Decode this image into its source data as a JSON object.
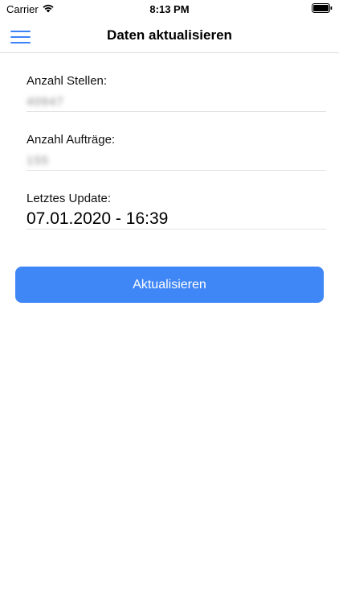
{
  "status_bar": {
    "carrier": "Carrier",
    "time": "8:13 PM",
    "wifi_icon": "wifi-icon",
    "battery_icon": "battery-icon"
  },
  "nav": {
    "title": "Daten aktualisieren",
    "menu_icon": "menu-icon",
    "accent_color": "#3d82f5"
  },
  "info": {
    "stellen_label": "Anzahl Stellen:",
    "stellen_value": "40947",
    "auftraege_label": "Anzahl Aufträge:",
    "auftraege_value": "155",
    "update_label": "Letztes Update:",
    "update_value": "07.01.2020 - 16:39"
  },
  "actions": {
    "update_button_label": "Aktualisieren",
    "button_color": "#3f86f7"
  }
}
